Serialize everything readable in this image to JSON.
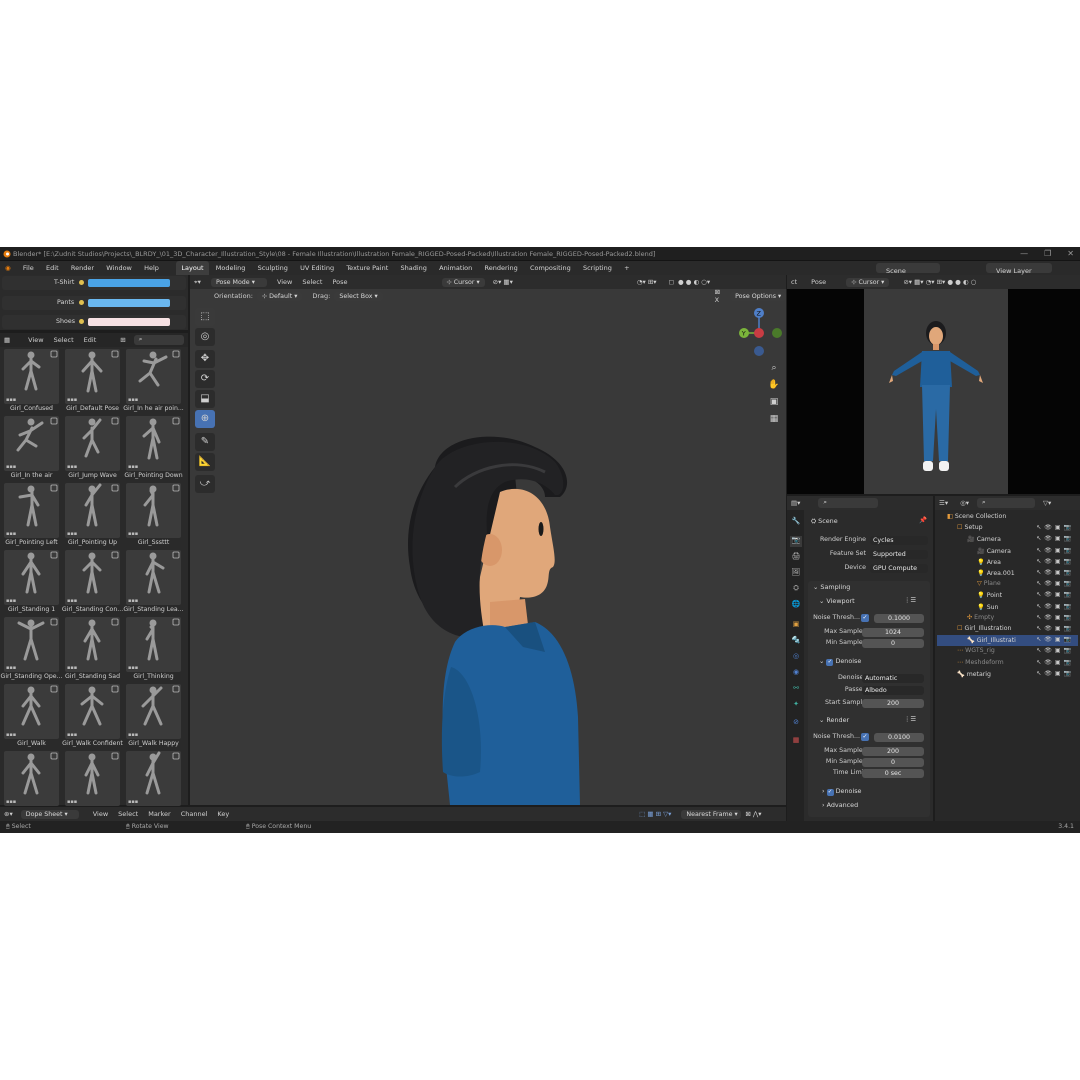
{
  "window": {
    "title": "Blender* [E:\\Zudnit Studios\\Projects\\_BLRDY_\\01_3D_Character_Illustration_Style\\08 - Female Illustration\\Illustration Female_RIGGED-Posed-Packed\\Illustration Female_RIGGED-Posed-Packed2.blend]",
    "controls": [
      "—",
      "❐",
      "✕"
    ]
  },
  "menu": [
    "File",
    "Edit",
    "Render",
    "Window",
    "Help"
  ],
  "workspaces": [
    "Layout",
    "Modeling",
    "Sculpting",
    "UV Editing",
    "Texture Paint",
    "Shading",
    "Animation",
    "Rendering",
    "Compositing",
    "Scripting"
  ],
  "add_tab": "+",
  "scene_field": "Scene",
  "view_layer_field": "View Layer",
  "color_props": [
    {
      "label": "T-Shirt",
      "color": "#4aa3e6"
    },
    {
      "label": "Pants",
      "color": "#6ab8f0"
    },
    {
      "label": "Shoes",
      "color": "#f7e1e3"
    }
  ],
  "asset_header": [
    "View",
    "Select",
    "Edit"
  ],
  "assets": [
    "Girl_Confused",
    "Girl_Default Pose",
    "Girl_In he air poin...",
    "Girl_In the air",
    "Girl_Jump Wave",
    "Girl_Pointing Down",
    "Girl_Pointing Left",
    "Girl_Pointing Up",
    "Girl_Sssttt",
    "Girl_Standing 1",
    "Girl_Standing Con...",
    "Girl_Standing Lea...",
    "Girl_Standing Ope...",
    "Girl_Standing Sad",
    "Girl_Thinking",
    "Girl_Walk",
    "Girl_Walk Confident",
    "Girl_Walk Happy",
    "",
    "",
    ""
  ],
  "viewport": {
    "mode": "Pose Mode",
    "menus": [
      "View",
      "Select",
      "Pose"
    ],
    "orientation_label": "Orientation:",
    "orientation_value": "Default",
    "drag_label": "Drag:",
    "drag_value": "Select Box",
    "pivot": "Cursor",
    "pose_options": "Pose Options",
    "gizmo": {
      "x": "X",
      "y": "Y",
      "z": "Z"
    },
    "colors": {
      "bg": "#393939",
      "shirt": "#1f5f9a",
      "hair": "#1b1b1d",
      "skin": "#e0a77a"
    }
  },
  "camera_view": {
    "header": [
      "ct",
      "Pose",
      "Cursor"
    ]
  },
  "dopesheet": {
    "editor": "Dope Sheet",
    "menus": [
      "View",
      "Select",
      "Marker",
      "Channel",
      "Key"
    ],
    "snap": "Nearest Frame"
  },
  "properties": {
    "title": "Scene",
    "render_engine_label": "Render Engine",
    "render_engine": "Cycles",
    "feature_set_label": "Feature Set",
    "feature_set": "Supported",
    "device_label": "Device",
    "device": "GPU Compute",
    "sampling": "Sampling",
    "viewport": "Viewport",
    "vp_noise_label": "Noise Thresh...",
    "vp_noise": "0.1000",
    "vp_max_label": "Max Samples",
    "vp_max": "1024",
    "vp_min_label": "Min Samples",
    "vp_min": "0",
    "denoise": "Denoise",
    "denoiser_label": "Denoiser",
    "denoiser": "Automatic",
    "passes_label": "Passes",
    "passes": "Albedo",
    "start_sample_label": "Start Sample",
    "start_sample": "200",
    "render": "Render",
    "r_noise_label": "Noise Thresh...",
    "r_noise": "0.0100",
    "r_max_label": "Max Samples",
    "r_max": "200",
    "r_min_label": "Min Samples",
    "r_min": "0",
    "time_limit_label": "Time Limit",
    "time_limit": "0 sec",
    "denoise2": "Denoise",
    "advanced": "Advanced"
  },
  "outliner": {
    "items": [
      {
        "name": "Scene Collection",
        "indent": 0,
        "selected": false
      },
      {
        "name": "Setup",
        "indent": 1,
        "selected": false
      },
      {
        "name": "Camera",
        "indent": 2,
        "selected": false
      },
      {
        "name": "Camera",
        "indent": 3,
        "selected": false
      },
      {
        "name": "Area",
        "indent": 3,
        "selected": false
      },
      {
        "name": "Area.001",
        "indent": 3,
        "selected": false
      },
      {
        "name": "Plane",
        "indent": 3,
        "selected": false
      },
      {
        "name": "Point",
        "indent": 3,
        "selected": false
      },
      {
        "name": "Sun",
        "indent": 3,
        "selected": false
      },
      {
        "name": "Empty",
        "indent": 2,
        "selected": false
      },
      {
        "name": "Girl_Illustration",
        "indent": 1,
        "selected": false
      },
      {
        "name": "Girl_Illustrati",
        "indent": 2,
        "selected": true
      },
      {
        "name": "WGTS_rig",
        "indent": 1,
        "selected": false
      },
      {
        "name": "Meshdeform",
        "indent": 1,
        "selected": false
      },
      {
        "name": "metarig",
        "indent": 1,
        "selected": false
      }
    ]
  },
  "status": {
    "select": "Select",
    "rotate": "Rotate View",
    "context": "Pose Context Menu",
    "version": "3.4.1"
  }
}
